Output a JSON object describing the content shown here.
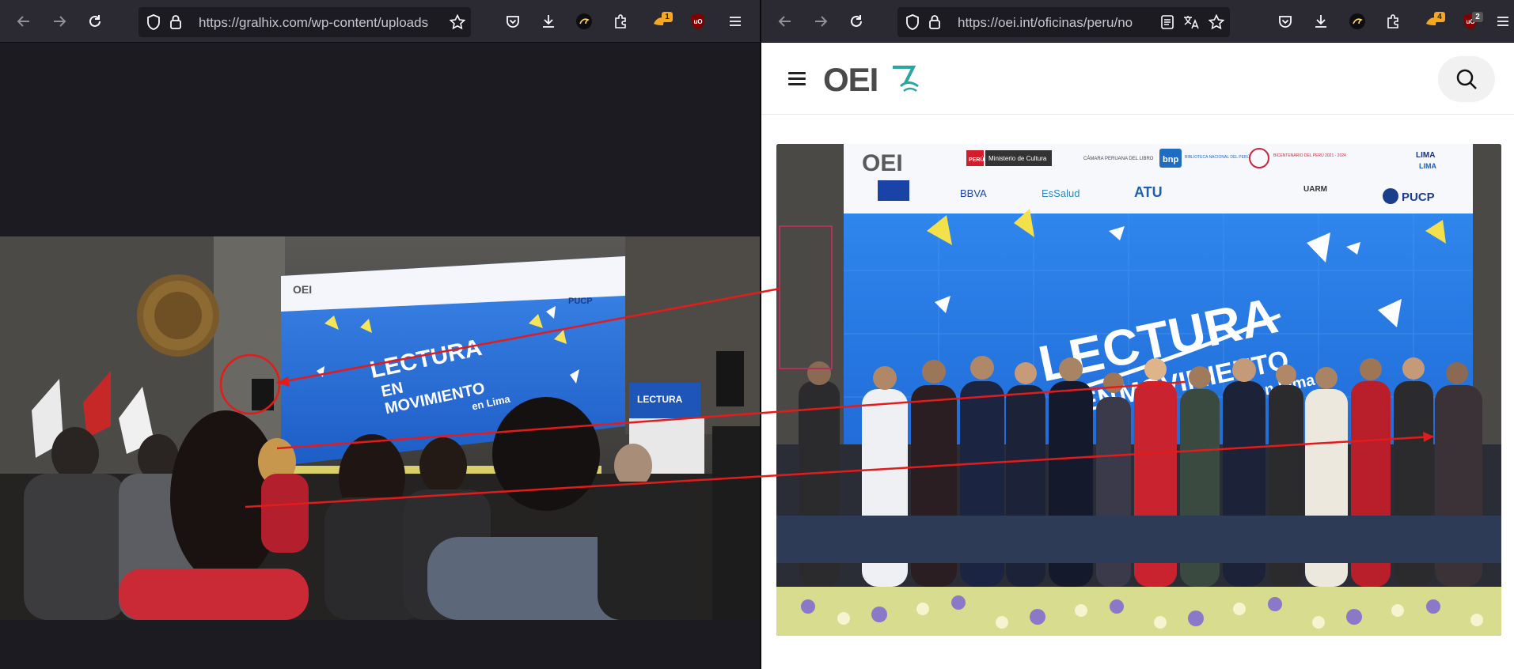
{
  "left_window": {
    "url": "https://gralhix.com/wp-content/uploads",
    "toolbar": {
      "back_icon": "arrow-left-icon",
      "forward_icon": "arrow-right-icon",
      "reload_icon": "reload-icon",
      "shield_icon": "tracking-shield-icon",
      "lock_icon": "lock-icon",
      "bookmark_icon": "star-icon",
      "pocket_icon": "pocket-icon",
      "download_icon": "download-icon",
      "ext1_icon": "extension-icon",
      "extensions_icon": "puzzle-icon",
      "ext2_badge": "1",
      "ublock_icon": "ublock-icon",
      "menu_icon": "hamburger-menu-icon"
    },
    "image": {
      "banner_brand": "OEI",
      "banner_title_1": "LECTURA",
      "banner_title_2": "EN",
      "banner_title_3": "MOVIMIENTO",
      "banner_sub": "en Lima",
      "side_banner": "LECTURA",
      "pucp": "PUCP"
    }
  },
  "right_window": {
    "url": "https://oei.int/oficinas/peru/no",
    "toolbar": {
      "reader_icon": "reader-view-icon",
      "translate_icon": "translate-icon",
      "ext2_badge": "4",
      "ublock_badge": "2"
    },
    "site": {
      "logo_text": "OEI",
      "menu_icon": "hamburger-menu-icon",
      "search_icon": "search-icon"
    },
    "photo": {
      "brand": "OEI",
      "peru": "PERÚ",
      "ministerio": "Ministerio de Cultura",
      "camara": "CÁMARA PERUANA DEL LIBRO",
      "bnp": "bnp",
      "bnp_sub": "BIBLIOTECA NACIONAL DEL PERÚ",
      "bicentenario": "BICENTENARIO DEL PERÚ 2021 - 2024",
      "lima1": "LIMA",
      "lima2": "LIMA",
      "bbva": "BBVA",
      "essalud": "EsSalud",
      "atu": "ATU",
      "uarm": "UARM",
      "pucp": "PUCP",
      "title_1": "LECTURA",
      "title_2": "EN",
      "title_3": "MOVIMIENTO",
      "sub": "en Lima"
    }
  },
  "colors": {
    "toolbar_bg": "#2b2a33",
    "urlbar_bg": "#1c1b22",
    "annotation_red": "#e31b1b",
    "screen_blue": "#1f6fd6",
    "ublock_red": "#800000"
  }
}
